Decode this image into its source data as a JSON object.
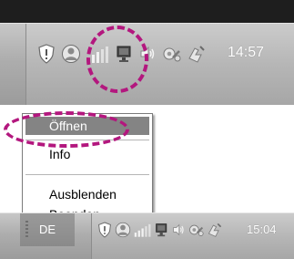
{
  "tray_top": {
    "clock": "14:57",
    "icons": [
      "shield-icon",
      "user-globe-icon",
      "signal-strength-icon",
      "network-monitor-icon",
      "speaker-icon",
      "gear-wrench-icon",
      "safely-remove-hardware-icon"
    ]
  },
  "context_menu": {
    "items": [
      "Öffnen",
      "Info",
      "Ausblenden",
      "Beenden"
    ],
    "highlighted_item": "Öffnen"
  },
  "tray_bottom": {
    "language": "DE",
    "clock": "15:04",
    "icons": [
      "shield-icon",
      "user-globe-icon",
      "signal-strength-icon",
      "network-monitor-icon",
      "speaker-icon",
      "gear-wrench-icon",
      "safely-remove-hardware-icon"
    ]
  },
  "colors": {
    "annotation": "#b3177e",
    "menu_highlight": "#848484",
    "taskbar": "#b4b4b4",
    "desktop_top": "#1e1e1e"
  }
}
